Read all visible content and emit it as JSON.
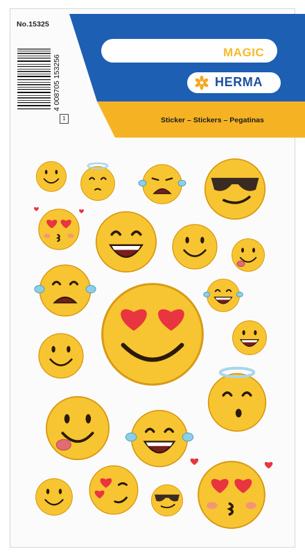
{
  "product": {
    "number": "No.15325",
    "barcode_digits": "4 008705 153256",
    "quantity": "1"
  },
  "brand": {
    "line": "MAGIC",
    "name": "HERMA",
    "tagline": "Sticker – Stickers – Pegatinas"
  },
  "colors": {
    "band_blue": "#1d5fb3",
    "band_yellow": "#f5b324",
    "herma_blue": "#1b4fa1",
    "magic_gold": "#f6ba2a",
    "smiley_yellow": "#f7c531"
  },
  "stickers": [
    {
      "kind": "smile"
    },
    {
      "kind": "angel-shy"
    },
    {
      "kind": "crying"
    },
    {
      "kind": "sunglasses"
    },
    {
      "kind": "heart-eyes-kiss"
    },
    {
      "kind": "laughing"
    },
    {
      "kind": "smile"
    },
    {
      "kind": "tongue"
    },
    {
      "kind": "crying-laugh"
    },
    {
      "kind": "tears-of-joy"
    },
    {
      "kind": "heart-eyes"
    },
    {
      "kind": "grin"
    },
    {
      "kind": "smile"
    },
    {
      "kind": "angel-wow"
    },
    {
      "kind": "tongue"
    },
    {
      "kind": "tears-of-joy"
    },
    {
      "kind": "smile"
    },
    {
      "kind": "heart-wink"
    },
    {
      "kind": "sunglasses"
    },
    {
      "kind": "heart-eyes-kiss"
    }
  ]
}
